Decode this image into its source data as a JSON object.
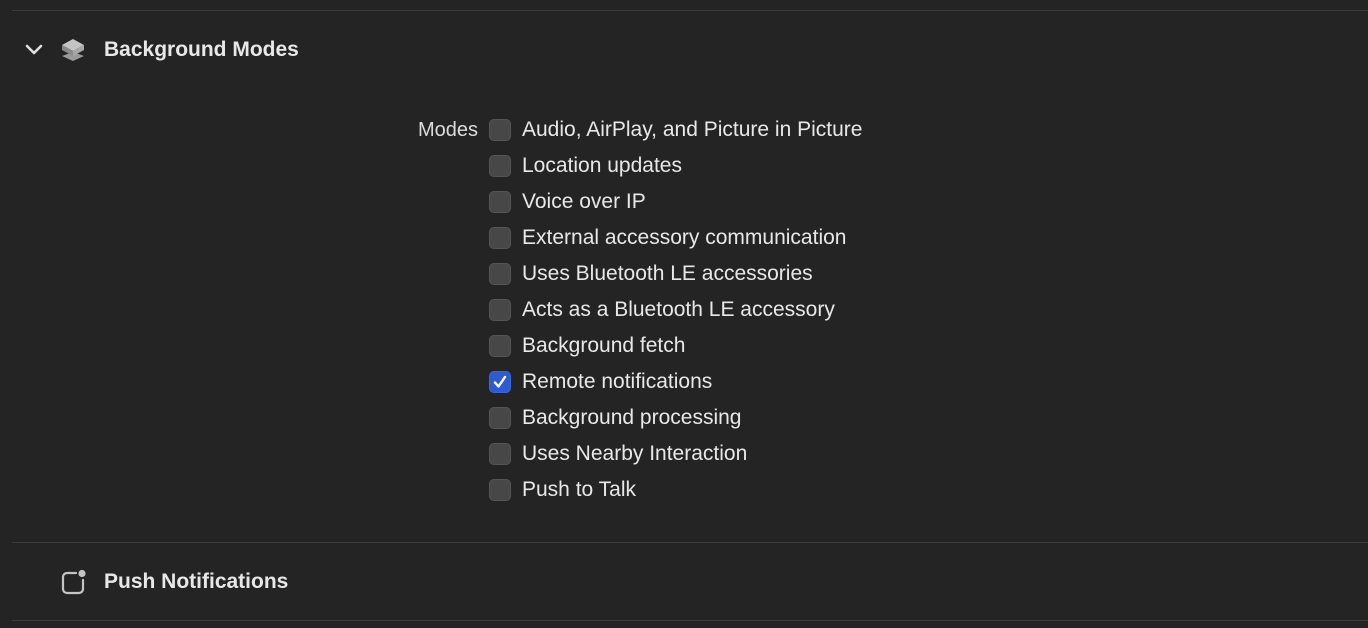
{
  "background_modes": {
    "title": "Background Modes",
    "expanded": true,
    "modes_label": "Modes",
    "modes": [
      {
        "label": "Audio, AirPlay, and Picture in Picture",
        "checked": false
      },
      {
        "label": "Location updates",
        "checked": false
      },
      {
        "label": "Voice over IP",
        "checked": false
      },
      {
        "label": "External accessory communication",
        "checked": false
      },
      {
        "label": "Uses Bluetooth LE accessories",
        "checked": false
      },
      {
        "label": "Acts as a Bluetooth LE accessory",
        "checked": false
      },
      {
        "label": "Background fetch",
        "checked": false
      },
      {
        "label": "Remote notifications",
        "checked": true
      },
      {
        "label": "Background processing",
        "checked": false
      },
      {
        "label": "Uses Nearby Interaction",
        "checked": false
      },
      {
        "label": "Push to Talk",
        "checked": false
      }
    ]
  },
  "push_notifications": {
    "title": "Push Notifications"
  },
  "colors": {
    "background": "#242424",
    "checkbox_checked": "#2f5bd0",
    "checkbox_unchecked": "#474747",
    "text": "#e8e8e8"
  },
  "icons": {
    "chevron": "chevron-down-icon",
    "background_modes": "layers-icon",
    "push_notifications": "notification-badge-icon"
  }
}
